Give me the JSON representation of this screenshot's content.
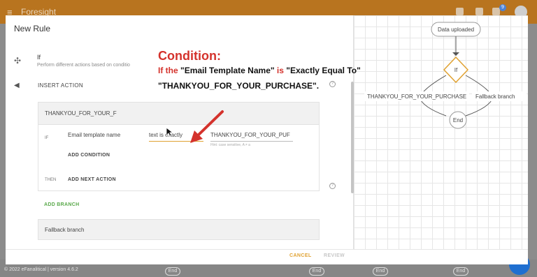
{
  "app": {
    "brand": "Foresight",
    "notification_count": "9",
    "version_text": "© 2022 eFanalitical | version 4.6.2",
    "end_label": "End"
  },
  "dialog": {
    "title": "New Rule",
    "action": {
      "title": "If",
      "subtitle": "Perform different actions based on conditio"
    },
    "insert_action": "INSERT ACTION",
    "branch": {
      "name": "THANKYOU_FOR_YOUR_F",
      "if_label": "IF",
      "field": "Email template name",
      "operator": "text is exactly",
      "value": "THANKYOU_FOR_YOUR_PUF",
      "hint": "Hint: case sensitive, A ≠ a",
      "add_condition": "ADD CONDITION",
      "then_label": "THEN",
      "add_next_action": "ADD NEXT ACTION"
    },
    "add_branch": "ADD BRANCH",
    "fallback_branch": "Fallback branch",
    "cancel": "CANCEL",
    "review": "REVIEW"
  },
  "annotation": {
    "title": "Condition:",
    "kw1": "If the",
    "part1": "\"Email Template Name\"",
    "kw2": "is",
    "part2": "\"Exactly Equal To\"",
    "line2": "\"THANKYOU_FOR_YOUR_PURCHASE\"."
  },
  "flowchart": {
    "start": "Data uploaded",
    "decision": "If",
    "left_branch": "THANKYOU_FOR_YOUR_PURCHASE",
    "right_branch": "Fallback branch",
    "end": "End"
  },
  "colors": {
    "accent": "#e0a232",
    "annotation_red": "#d4322c",
    "branch_green": "#5aa94b",
    "appbar": "#b8741f"
  },
  "icons": {
    "menu": "menu-icon",
    "if": "branch-icon",
    "back": "arrow-left-icon",
    "help": "help-icon"
  }
}
